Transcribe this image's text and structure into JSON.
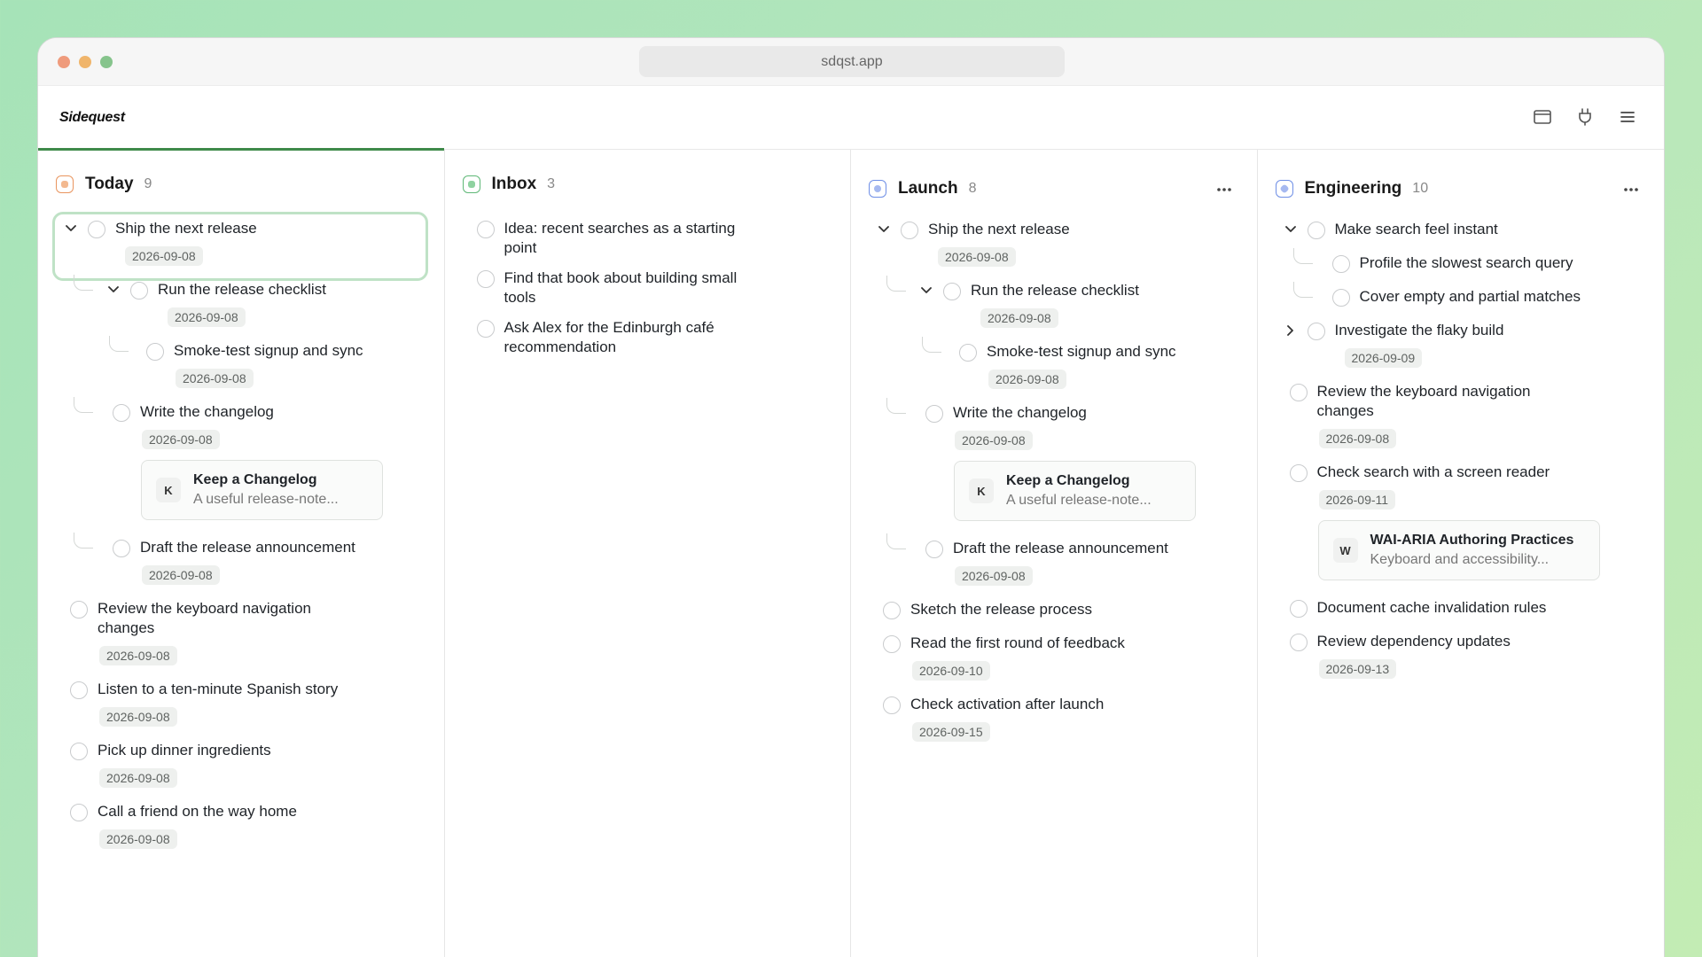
{
  "browser": {
    "url": "sdqst.app"
  },
  "app": {
    "name": "Sidequest"
  },
  "icons": {
    "panel": "panel-icon",
    "plug": "plug-icon",
    "menu": "menu-icon",
    "more": "more-icon",
    "chevron": "chevron-icon"
  },
  "colors": {
    "accent": "#3f8a4a",
    "today": "#e9955f",
    "inbox": "#5fb877",
    "launch": "#6f8fe6",
    "engineering": "#6f8fe6"
  },
  "columns": [
    {
      "title": "Today",
      "count": "9",
      "tasks": [
        {
          "title": "Ship the next release",
          "date": "2026-09-08"
        },
        {
          "title": "Run the release checklist",
          "date": "2026-09-08"
        },
        {
          "title": "Smoke-test signup and sync",
          "date": "2026-09-08"
        },
        {
          "title": "Write the changelog",
          "date": "2026-09-08",
          "link": {
            "badge": "K",
            "title": "Keep a Changelog",
            "desc": "A useful release-note..."
          }
        },
        {
          "title": "Draft the release announcement",
          "date": "2026-09-08"
        },
        {
          "title": "Review the keyboard navigation changes",
          "date": "2026-09-08"
        },
        {
          "title": "Listen to a ten-minute Spanish story",
          "date": "2026-09-08"
        },
        {
          "title": "Pick up dinner ingredients",
          "date": "2026-09-08"
        },
        {
          "title": "Call a friend on the way home",
          "date": "2026-09-08"
        }
      ]
    },
    {
      "title": "Inbox",
      "count": "3",
      "tasks": [
        {
          "title": "Idea: recent searches as a starting point"
        },
        {
          "title": "Find that book about building small tools"
        },
        {
          "title": "Ask Alex for the Edinburgh café recommendation"
        }
      ]
    },
    {
      "title": "Launch",
      "count": "8",
      "tasks": [
        {
          "title": "Ship the next release",
          "date": "2026-09-08"
        },
        {
          "title": "Run the release checklist",
          "date": "2026-09-08"
        },
        {
          "title": "Smoke-test signup and sync",
          "date": "2026-09-08"
        },
        {
          "title": "Write the changelog",
          "date": "2026-09-08",
          "link": {
            "badge": "K",
            "title": "Keep a Changelog",
            "desc": "A useful release-note..."
          }
        },
        {
          "title": "Draft the release announcement",
          "date": "2026-09-08"
        },
        {
          "title": "Sketch the release process"
        },
        {
          "title": "Read the first round of feedback",
          "date": "2026-09-10"
        },
        {
          "title": "Check activation after launch",
          "date": "2026-09-15"
        }
      ]
    },
    {
      "title": "Engineering",
      "count": "10",
      "tasks": [
        {
          "title": "Make search feel instant"
        },
        {
          "title": "Profile the slowest search query"
        },
        {
          "title": "Cover empty and partial matches"
        },
        {
          "title": "Investigate the flaky build",
          "date": "2026-09-09"
        },
        {
          "title": "Review the keyboard navigation changes",
          "date": "2026-09-08"
        },
        {
          "title": "Check search with a screen reader",
          "date": "2026-09-11",
          "link": {
            "badge": "W",
            "title": "WAI-ARIA Authoring Practices",
            "desc": "Keyboard and accessibility..."
          }
        },
        {
          "title": "Document cache invalidation rules"
        },
        {
          "title": "Review dependency updates",
          "date": "2026-09-13"
        }
      ]
    }
  ]
}
